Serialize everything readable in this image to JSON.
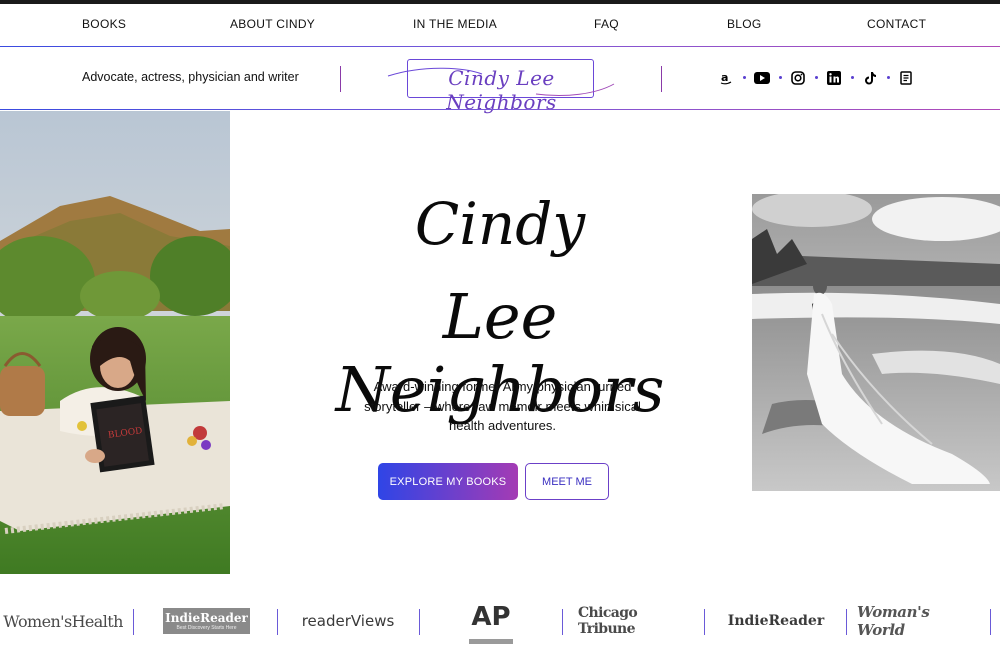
{
  "nav": {
    "items": [
      "BOOKS",
      "ABOUT CINDY",
      "IN THE MEDIA",
      "FAQ",
      "BLOG",
      "CONTACT"
    ]
  },
  "header": {
    "tagline": "Advocate, actress, physician and writer",
    "logo_text": "Cindy Lee Neighbors",
    "socials": [
      "amazon-icon",
      "youtube-icon",
      "instagram-icon",
      "linkedin-icon",
      "tiktok-icon",
      "book-icon"
    ]
  },
  "hero": {
    "name_line1": "Cindy",
    "name_line2": "Lee Neighbors",
    "subtitle": "Award-winning former Army physician turned storyteller – where raw memoir meets whimsical health adventures.",
    "primary_button": "EXPLORE MY BOOKS",
    "secondary_button": "MEET ME"
  },
  "press": {
    "logos": [
      "Women'sHealth",
      "IndieReader",
      "readerViews",
      "AP",
      "Chicago Tribune",
      "IndieReader",
      "Woman's World"
    ],
    "indiereader_tag": "Best Discovery Starts Here"
  },
  "colors": {
    "accent_blue": "#2f45e6",
    "accent_purple": "#a43bb4",
    "text": "#111111"
  }
}
